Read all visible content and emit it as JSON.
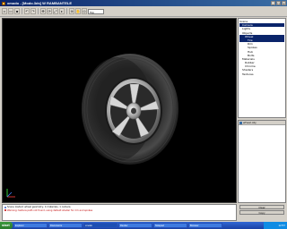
{
  "window": {
    "title": "xmodo - [Modo.3ds] W RAMBANTELE"
  },
  "toolbar": {
    "buttons": [
      "new",
      "open",
      "save",
      "undo",
      "redo",
      "move",
      "rotate",
      "scale",
      "select",
      "zoom",
      "pan",
      "orbit"
    ],
    "view_select": "Top"
  },
  "tree": {
    "items": [
      {
        "label": "Scene",
        "indent": 0,
        "selected": false
      },
      {
        "label": "Camera",
        "indent": 1,
        "selected": true
      },
      {
        "label": "Lights",
        "indent": 1,
        "selected": false
      },
      {
        "label": "Objects",
        "indent": 1,
        "selected": false
      },
      {
        "label": "Wheel",
        "indent": 2,
        "selected": true
      },
      {
        "label": "Tire",
        "indent": 3,
        "selected": true
      },
      {
        "label": "Rim",
        "indent": 3,
        "selected": false
      },
      {
        "label": "Spokes",
        "indent": 3,
        "selected": false
      },
      {
        "label": "Hub",
        "indent": 3,
        "selected": false
      },
      {
        "label": "Bolts",
        "indent": 3,
        "selected": false
      },
      {
        "label": "Materials",
        "indent": 1,
        "selected": false
      },
      {
        "label": "Rubber",
        "indent": 2,
        "selected": false
      },
      {
        "label": "Chrome",
        "indent": 2,
        "selected": false
      },
      {
        "label": "Shaders",
        "indent": 1,
        "selected": false
      },
      {
        "label": "Textures",
        "indent": 1,
        "selected": false
      }
    ]
  },
  "props": {
    "header": "wheel.obj"
  },
  "console": {
    "lines": [
      {
        "text": "Scene loaded: wheel geometry, 4 materials, 1 camera",
        "type": "info"
      },
      {
        "text": "Warning: texture path not found, using default shader for rim and spokes",
        "type": "err"
      }
    ]
  },
  "console_buttons": {
    "clear": "Clear",
    "copy": "Copy"
  },
  "taskbar": {
    "start": "start",
    "tasks": [
      {
        "label": "Explorer",
        "active": false
      },
      {
        "label": "Documents",
        "active": false
      },
      {
        "label": "xmodo",
        "active": true
      },
      {
        "label": "Render",
        "active": false
      },
      {
        "label": "Notepad",
        "active": false
      },
      {
        "label": "Browser",
        "active": false
      }
    ],
    "clock": "12:57"
  }
}
